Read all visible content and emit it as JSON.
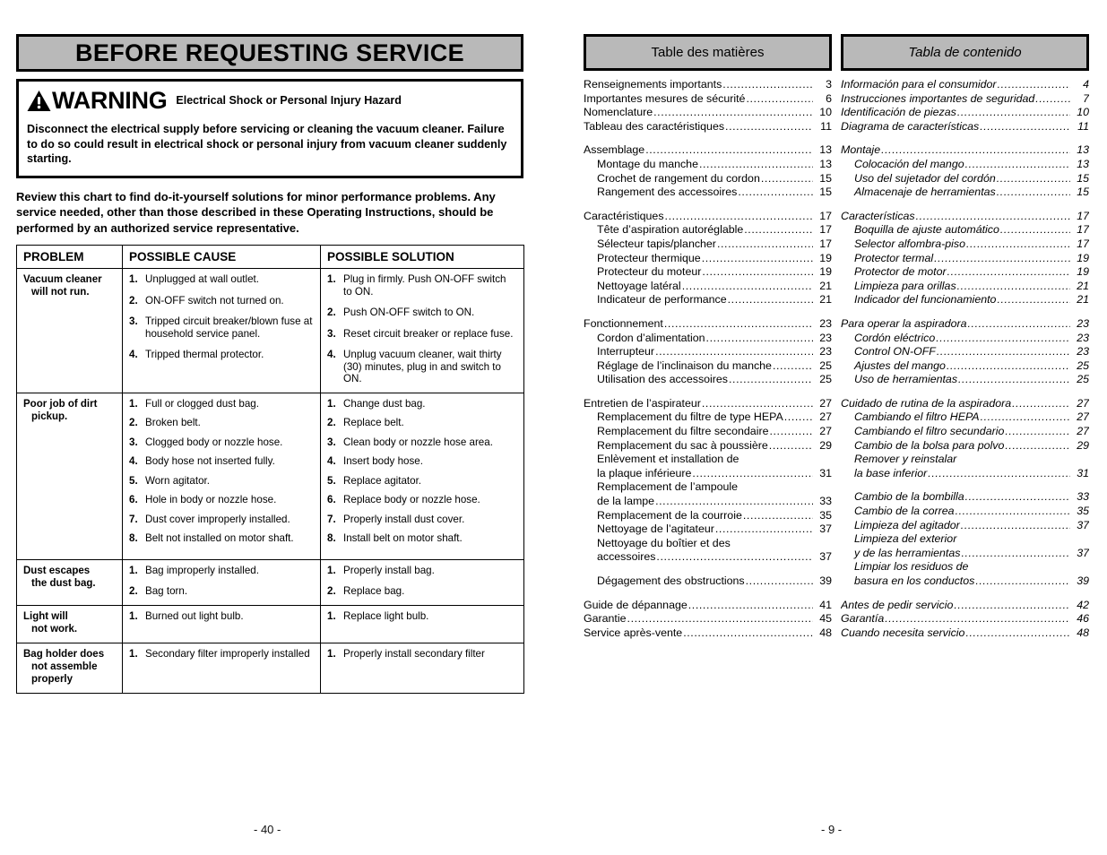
{
  "left_panel": {
    "banner_title": "BEFORE REQUESTING SERVICE",
    "warning": {
      "icon": "warning-triangle-icon",
      "word": "WARNING",
      "subtitle": "Electrical Shock or Personal Injury Hazard",
      "body": "Disconnect the electrical supply before servicing or cleaning the vacuum cleaner. Failure to do so could result in electrical shock or personal injury from vacuum cleaner suddenly starting."
    },
    "intro": "Review this chart to find do-it-yourself solutions for minor performance problems. Any service needed, other than those described in these Operating Instructions, should be performed by an authorized service representative.",
    "table": {
      "headers": [
        "PROBLEM",
        "POSSIBLE CAUSE",
        "POSSIBLE SOLUTION"
      ],
      "rows": [
        {
          "problem": "Vacuum cleaner",
          "problem_cont": "will not run.",
          "causes": [
            "Unplugged at wall outlet.",
            "ON-OFF switch not turned on.",
            "Tripped circuit breaker/blown fuse at household service panel.",
            "Tripped thermal protector."
          ],
          "solutions": [
            "Plug in firmly. Push ON-OFF switch to ON.",
            "Push ON-OFF switch to ON.",
            "Reset circuit breaker or replace fuse.",
            "Unplug vacuum cleaner, wait thirty (30) minutes, plug in and switch to ON."
          ]
        },
        {
          "problem": "Poor job of dirt",
          "problem_cont": "pickup.",
          "causes": [
            "Full or clogged dust bag.",
            "Broken belt.",
            "Clogged body or nozzle hose.",
            "Body hose not inserted fully.",
            "Worn agitator.",
            "Hole in body or nozzle hose.",
            "Dust cover improperly installed.",
            "Belt not installed on motor shaft."
          ],
          "solutions": [
            "Change dust bag.",
            "Replace belt.",
            "Clean body or nozzle hose area.",
            "Insert body hose.",
            "Replace agitator.",
            "Replace body or nozzle hose.",
            "Properly install dust cover.",
            "Install belt on motor shaft."
          ]
        },
        {
          "problem": "Dust escapes",
          "problem_cont": "the dust bag.",
          "causes": [
            "Bag improperly installed.",
            "Bag torn."
          ],
          "solutions": [
            "Properly install bag.",
            "Replace bag."
          ]
        },
        {
          "problem": "Light will",
          "problem_cont": "not work.",
          "causes": [
            "Burned out light bulb."
          ],
          "solutions": [
            "Replace light bulb."
          ]
        },
        {
          "problem": "Bag holder does",
          "problem_cont": "not assemble\nproperly",
          "causes": [
            "Secondary filter improperly installed"
          ],
          "solutions": [
            "Properly install secondary filter"
          ]
        }
      ]
    },
    "page_number": "- 40 -"
  },
  "french_toc": {
    "banner_title": "Table des matières",
    "groups": [
      {
        "entries": [
          {
            "label": "Renseignements importants",
            "page": "3",
            "indent": false
          },
          {
            "label": "Importantes mesures de sécurité",
            "page": "6",
            "indent": false
          },
          {
            "label": "Nomenclature",
            "page": "10",
            "indent": false
          },
          {
            "label": "Tableau des caractéristiques",
            "page": "11",
            "indent": false
          }
        ]
      },
      {
        "entries": [
          {
            "label": "Assemblage",
            "page": "13",
            "indent": false
          },
          {
            "label": "Montage du manche",
            "page": "13",
            "indent": true
          },
          {
            "label": "Crochet de rangement du cordon",
            "page": "15",
            "indent": true
          },
          {
            "label": "Rangement des accessoires",
            "page": "15",
            "indent": true
          }
        ]
      },
      {
        "entries": [
          {
            "label": "Caractéristiques",
            "page": "17",
            "indent": false
          },
          {
            "label": "Tête d’aspiration autoréglable",
            "page": "17",
            "indent": true
          },
          {
            "label": "Sélecteur tapis/plancher",
            "page": "17",
            "indent": true
          },
          {
            "label": "Protecteur thermique",
            "page": "19",
            "indent": true
          },
          {
            "label": "Protecteur du moteur",
            "page": "19",
            "indent": true
          },
          {
            "label": "Nettoyage latéral",
            "page": "21",
            "indent": true
          },
          {
            "label": "Indicateur de performance",
            "page": "21",
            "indent": true
          }
        ]
      },
      {
        "entries": [
          {
            "label": "Fonctionnement",
            "page": "23",
            "indent": false
          },
          {
            "label": "Cordon d’alimentation",
            "page": "23",
            "indent": true
          },
          {
            "label": "Interrupteur",
            "page": "23",
            "indent": true
          },
          {
            "label": "Réglage de l’inclinaison du manche",
            "page": "25",
            "indent": true
          },
          {
            "label": "Utilisation des accessoires",
            "page": "25",
            "indent": true
          }
        ]
      },
      {
        "entries": [
          {
            "label": "Entretien de l’aspirateur",
            "page": "27",
            "indent": false
          },
          {
            "label": "Remplacement du filtre de type HEPA",
            "page": "27",
            "indent": true
          },
          {
            "label": "Remplacement du filtre secondaire",
            "page": "27",
            "indent": true
          },
          {
            "label": "Remplacement du sac à poussière",
            "page": "29",
            "indent": true
          },
          {
            "label": "Enlèvement et installation de",
            "page": "",
            "indent": true,
            "no_dots": true,
            "no_page": true
          },
          {
            "label": "la plaque inférieure",
            "page": "31",
            "indent": true
          },
          {
            "label": "Remplacement de l’ampoule",
            "page": "",
            "indent": true,
            "no_dots": true,
            "no_page": true
          },
          {
            "label": "de la lampe",
            "page": "33",
            "indent": true
          },
          {
            "label": "Remplacement de la courroie",
            "page": "35",
            "indent": true
          },
          {
            "label": "Nettoyage de l’agitateur",
            "page": "37",
            "indent": true
          },
          {
            "label": "Nettoyage du boîtier et des",
            "page": "",
            "indent": true,
            "no_dots": true,
            "no_page": true
          },
          {
            "label": "accessoires",
            "page": "37",
            "indent": true
          }
        ]
      },
      {
        "entries": [
          {
            "label": "Dégagement des obstructions",
            "page": "39",
            "indent": true
          }
        ]
      },
      {
        "entries": [
          {
            "label": "Guide de dépannage",
            "page": "41",
            "indent": false
          },
          {
            "label": "Garantie",
            "page": "45",
            "indent": false
          },
          {
            "label": "Service après-vente",
            "page": "48",
            "indent": false
          }
        ]
      }
    ]
  },
  "spanish_toc": {
    "banner_title": "Tabla de contenido",
    "groups": [
      {
        "entries": [
          {
            "label": "Información para el consumidor",
            "page": "4",
            "indent": false
          },
          {
            "label": "Instrucciones importantes de seguridad",
            "page": "7",
            "indent": false
          },
          {
            "label": "Identificación de piezas",
            "page": "10",
            "indent": false
          },
          {
            "label": "Diagrama de características",
            "page": "11",
            "indent": false
          }
        ]
      },
      {
        "entries": [
          {
            "label": "Montaje",
            "page": "13",
            "indent": false
          },
          {
            "label": "Colocación del mango",
            "page": "13",
            "indent": true
          },
          {
            "label": "Uso del sujetador del cordón",
            "page": "15",
            "indent": true
          },
          {
            "label": "Almacenaje de herramientas",
            "page": "15",
            "indent": true
          }
        ]
      },
      {
        "entries": [
          {
            "label": "Características",
            "page": "17",
            "indent": false
          },
          {
            "label": "Boquilla de ajuste automático",
            "page": "17",
            "indent": true
          },
          {
            "label": "Selector alfombra-piso",
            "page": "17",
            "indent": true
          },
          {
            "label": "Protector termal",
            "page": "19",
            "indent": true
          },
          {
            "label": "Protector de motor",
            "page": "19",
            "indent": true
          },
          {
            "label": "Limpieza para orillas",
            "page": "21",
            "indent": true
          },
          {
            "label": "Indicador del funcionamiento",
            "page": "21",
            "indent": true
          }
        ]
      },
      {
        "entries": [
          {
            "label": "Para operar la aspiradora",
            "page": "23",
            "indent": false
          },
          {
            "label": "Cordón eléctrico",
            "page": "23",
            "indent": true
          },
          {
            "label": "Control ON-OFF",
            "page": "23",
            "indent": true
          },
          {
            "label": "Ajustes del mango",
            "page": "25",
            "indent": true
          },
          {
            "label": "Uso de herramientas",
            "page": "25",
            "indent": true
          }
        ]
      },
      {
        "entries": [
          {
            "label": "Cuidado de rutina de la aspiradora",
            "page": "27",
            "indent": false
          },
          {
            "label": "Cambiando el filtro HEPA",
            "page": "27",
            "indent": true
          },
          {
            "label": "Cambiando el filtro secundario",
            "page": "27",
            "indent": true
          },
          {
            "label": "Cambio de la bolsa para polvo",
            "page": "29",
            "indent": true
          },
          {
            "label": "Remover y reinstalar",
            "page": "",
            "indent": true,
            "no_dots": true,
            "no_page": true
          },
          {
            "label": "la base inferior",
            "page": "31",
            "indent": true
          }
        ]
      },
      {
        "entries": [
          {
            "label": "Cambio de la bombilla",
            "page": "33",
            "indent": true
          },
          {
            "label": "Cambio de la correa",
            "page": "35",
            "indent": true
          },
          {
            "label": "Limpieza del agitador",
            "page": "37",
            "indent": true
          },
          {
            "label": "Limpieza del exterior",
            "page": "",
            "indent": true,
            "no_dots": true,
            "no_page": true
          },
          {
            "label": "y de las herramientas",
            "page": "37",
            "indent": true
          },
          {
            "label": "Limpiar los residuos de",
            "page": "",
            "indent": true,
            "no_dots": true,
            "no_page": true
          },
          {
            "label": "basura en los conductos",
            "page": "39",
            "indent": true
          }
        ]
      },
      {
        "entries": [
          {
            "label": "Antes de pedir servicio",
            "page": "42",
            "indent": false
          },
          {
            "label": "Garantía",
            "page": "46",
            "indent": false
          },
          {
            "label": "Cuando necesita servicio",
            "page": "48",
            "indent": false
          }
        ]
      }
    ],
    "page_number": "- 9 -"
  },
  "colors": {
    "banner_gray": "#b9b9b9",
    "rule_black": "#000000",
    "page_background": "#ffffff"
  }
}
